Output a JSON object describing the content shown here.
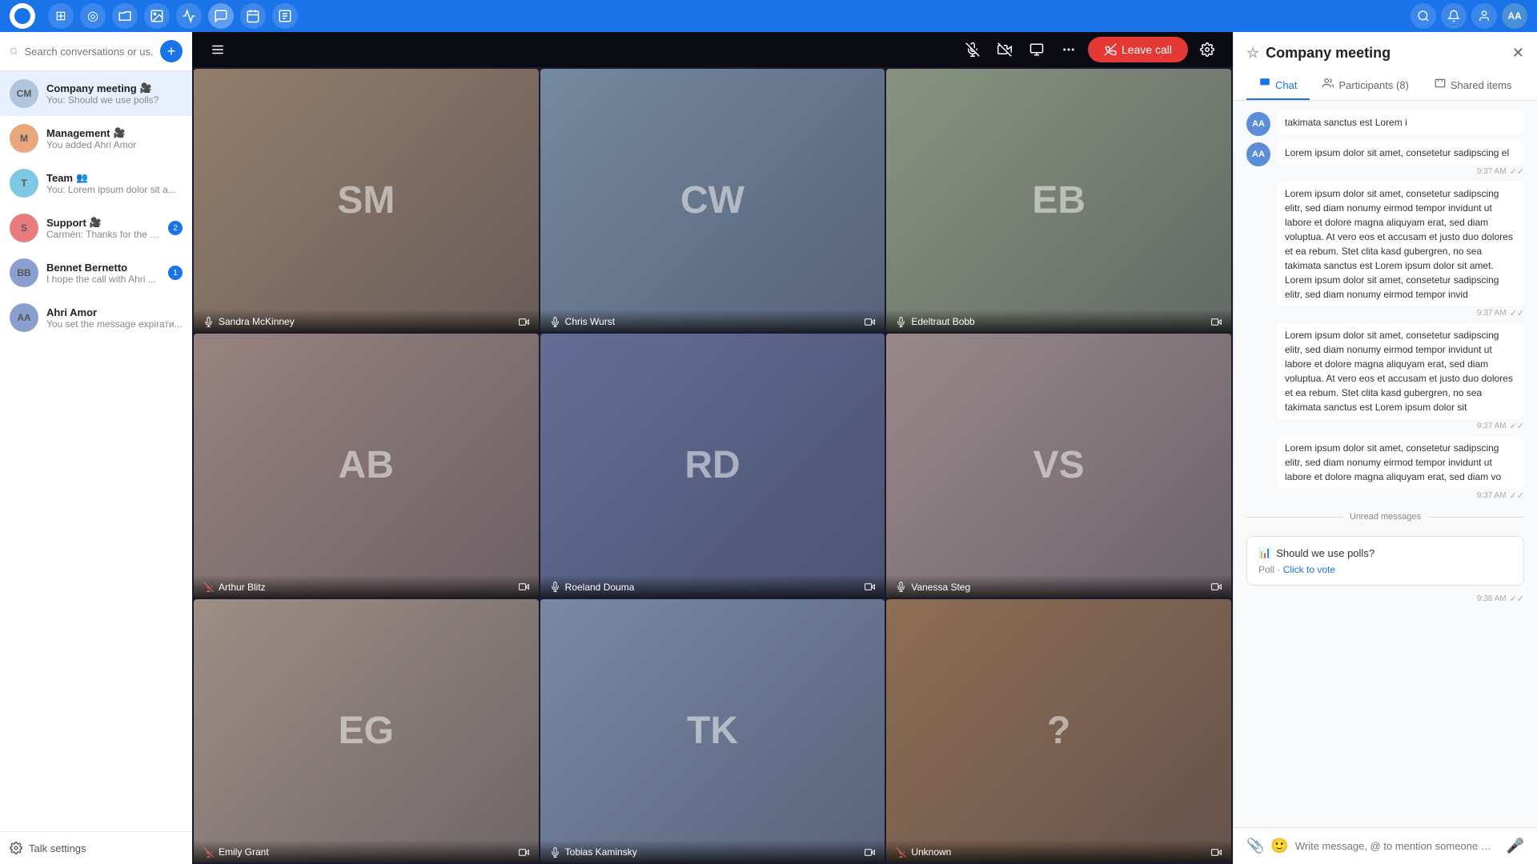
{
  "app": {
    "title": "Nextcloud Talk"
  },
  "topnav": {
    "logo_label": "Nextcloud",
    "icons": [
      {
        "name": "files",
        "symbol": "⊞",
        "active": false
      },
      {
        "name": "search",
        "symbol": "◎",
        "active": false
      },
      {
        "name": "folder",
        "symbol": "⬜",
        "active": false
      },
      {
        "name": "image",
        "symbol": "🖼",
        "active": false
      },
      {
        "name": "activity",
        "symbol": "⚡",
        "active": false
      },
      {
        "name": "talk",
        "symbol": "💬",
        "active": true
      },
      {
        "name": "calendar",
        "symbol": "📅",
        "active": false
      },
      {
        "name": "notes",
        "symbol": "📋",
        "active": false
      }
    ],
    "right_icons": [
      "search",
      "bell",
      "person"
    ],
    "avatar_initials": "AA"
  },
  "sidebar": {
    "search_placeholder": "Search conversations or us...",
    "new_conv_label": "+",
    "conversations": [
      {
        "id": "company",
        "name": "Company meeting",
        "emoji": "🎥",
        "preview": "You: Should we use polls?",
        "avatar_type": "group",
        "avatar_text": "CM",
        "active": true,
        "badge": null
      },
      {
        "id": "management",
        "name": "Management",
        "emoji": "🎥",
        "preview": "You added Ahri Amor",
        "avatar_type": "group",
        "avatar_text": "M",
        "active": false,
        "badge": null
      },
      {
        "id": "team",
        "name": "Team",
        "emoji": "👥",
        "preview": "You: Lorem ipsum dolor sit a...",
        "avatar_type": "group",
        "avatar_text": "T",
        "active": false,
        "badge": null
      },
      {
        "id": "support",
        "name": "Support",
        "emoji": "🎥",
        "preview": "Carmèn: Thanks for the li...",
        "avatar_type": "group",
        "avatar_text": "S",
        "active": false,
        "badge": 2
      },
      {
        "id": "bennet",
        "name": "Bennet Bernetto",
        "emoji": "",
        "preview": "I hope the call with Ahri ...",
        "avatar_type": "user",
        "avatar_text": "BB",
        "active": false,
        "badge": 1
      },
      {
        "id": "ahri",
        "name": "Ahri Amor",
        "emoji": "",
        "preview": "You set the message expirати...",
        "avatar_type": "user",
        "avatar_text": "AA",
        "active": false,
        "badge": null
      }
    ],
    "settings_label": "Talk settings"
  },
  "video": {
    "topbar": {
      "more_options_label": "⋯",
      "leave_btn_label": "Leave call",
      "leave_icon": "📞"
    },
    "participants": [
      {
        "name": "Sandra McKinney",
        "mic": true,
        "cam": true,
        "color": "#c8a882"
      },
      {
        "name": "Chris Wurst",
        "mic": true,
        "cam": true,
        "color": "#9ab8d0"
      },
      {
        "name": "Edeltraut Bobb",
        "mic": true,
        "cam": true,
        "color": "#b8c8a0"
      },
      {
        "name": "Arthur Blitz",
        "mic": false,
        "cam": false,
        "color": "#d0b0a0"
      },
      {
        "name": "Roeland Douma",
        "mic": true,
        "cam": true,
        "color": "#8090c0"
      },
      {
        "name": "Vanessa Steg",
        "mic": true,
        "cam": true,
        "color": "#d0b8b0"
      },
      {
        "name": "Emily Grant",
        "mic": false,
        "cam": false,
        "color": "#d8c0a8"
      },
      {
        "name": "Tobias Kaminsky",
        "mic": true,
        "cam": false,
        "color": "#a0b8d8"
      },
      {
        "name": "Unknown",
        "mic": false,
        "cam": false,
        "color": "#c09060"
      }
    ]
  },
  "chat": {
    "title": "Company meeting",
    "tabs": [
      {
        "id": "chat",
        "label": "Chat",
        "icon": "💬",
        "active": true
      },
      {
        "id": "participants",
        "label": "Participants (8)",
        "icon": "👤",
        "active": false
      },
      {
        "id": "shared",
        "label": "Shared items",
        "icon": "📁",
        "active": false
      }
    ],
    "messages": [
      {
        "id": 1,
        "avatar": "AA",
        "text": "takimata sanctus est Lorem i",
        "time": null,
        "has_check": false
      },
      {
        "id": 2,
        "avatar": "AA",
        "text": "Lorem ipsum dolor sit amet, consetetur sadipscing el",
        "time": "9:37 AM",
        "has_check": true
      },
      {
        "id": 3,
        "avatar": null,
        "text": "Lorem ipsum dolor sit amet, consetetur sadipscing elitr, sed diam nonumy eirmod tempor invidunt ut labore et dolore magna aliquyam erat, sed diam voluptua. At vero eos et accusam et justo duo dolores et ea rebum. Stet clita kasd gubergren, no sea takimata sanctus est Lorem ipsum dolor sit amet. Lorem ipsum dolor sit amet, consetetur sadipscing elitr, sed diam nonumy eirmod tempor invid",
        "time": "9:37 AM",
        "has_check": true
      },
      {
        "id": 4,
        "avatar": null,
        "text": "Lorem ipsum dolor sit amet, consetetur sadipscing elitr, sed diam nonumy eirmod tempor invidunt ut labore et dolore magna aliquyam erat, sed diam voluptua. At vero eos et accusam et justo duo dolores et ea rebum. Stet clita kasd gubergren, no sea takimata sanctus est Lorem ipsum dolor sit",
        "time": "9:37 AM",
        "has_check": true
      },
      {
        "id": 5,
        "avatar": null,
        "text": "Lorem ipsum dolor sit amet, consetetur sadipscing elitr, sed diam nonumy eirmod tempor invidunt ut labore et dolore magna aliquyam erat, sed diam vo",
        "time": "9:37 AM",
        "has_check": true
      }
    ],
    "unread_label": "Unread messages",
    "poll": {
      "title": "Should we use polls?",
      "type": "Poll",
      "action": "Click to vote",
      "time": "9:38 AM"
    },
    "input_placeholder": "Write message, @ to mention someone …"
  }
}
